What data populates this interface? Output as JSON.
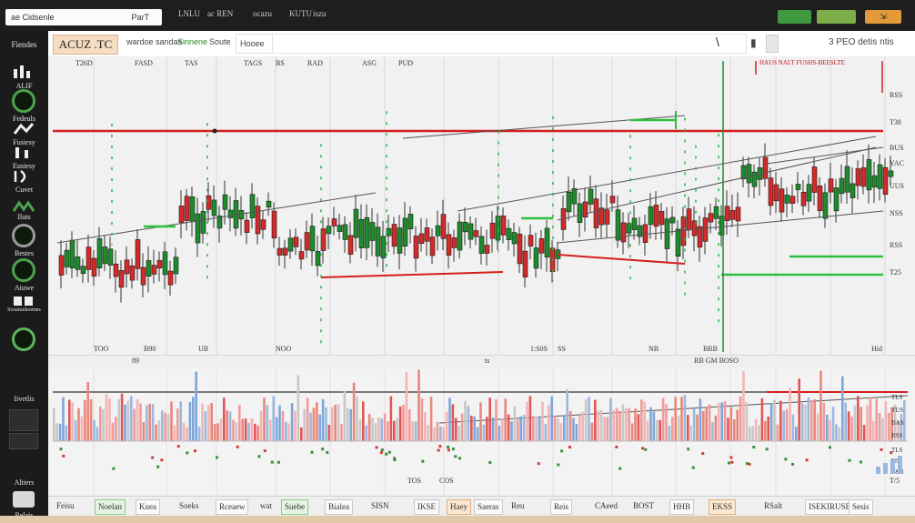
{
  "topbar": {
    "address": "ae Cidsenle",
    "address_right": "ParT",
    "menus": [
      "LNLU",
      "ac REN",
      "ocazu",
      "KUTU",
      "iszu"
    ],
    "buttons": [
      {
        "color": "#3f9a3f"
      },
      {
        "color": "#7eae4a"
      },
      {
        "color": "#e59a3a"
      }
    ]
  },
  "sidebar": {
    "title": "Fiendes",
    "items": [
      {
        "label": "ALIF",
        "icon": "chart-icon"
      },
      {
        "label": "Fedeuls",
        "icon": "ring-icon"
      },
      {
        "label": "Fusiesy",
        "icon": "candle-icon"
      },
      {
        "label": "Eusiesy",
        "icon": "bars-icon"
      },
      {
        "label": "Cuvet",
        "icon": "line-icon"
      },
      {
        "label": "Iluts",
        "icon": "wave-icon"
      },
      {
        "label": "Bestes",
        "icon": "ring-icon"
      },
      {
        "label": "Aiuwe",
        "icon": "ring-icon"
      },
      {
        "label": "Scoatunlenrnes",
        "icon": "grid-icon"
      },
      {
        "label": "Iivetlis",
        "icon": "ring-icon"
      },
      {
        "label": "Altiers",
        "icon": "square-icon"
      },
      {
        "label": "Relais",
        "icon": "square-icon"
      }
    ]
  },
  "toolbar": {
    "symbol": "ACUZ .TC",
    "labels": [
      "wardoe sandas",
      "Sinnene",
      "Soute",
      "Hooee"
    ],
    "right_label": "3 PEO detis ntis",
    "pencil": "\\",
    "zoom": "▮"
  },
  "price_axis": {
    "top_text": "HAUS NALT FUSHS-BEESLTE",
    "labels": [
      "RSS",
      "T38",
      "BUS",
      "YAC",
      "UUS",
      "NSS",
      "RSS",
      "T25"
    ]
  },
  "chart_top_labels": [
    "T26D",
    "FASD",
    "TAS",
    "TAGS",
    "BS",
    "RAD",
    "ASG",
    "PUD"
  ],
  "time_axis": [
    "TOO",
    "B90",
    "UB",
    "NOO",
    "1:S0S",
    "SS",
    "NB",
    "BRB",
    "Hid"
  ],
  "divider": {
    "left": "89",
    "mid": "ts",
    "right": "RB GM BOSO"
  },
  "volume_axis": [
    "TLS",
    "TUS",
    "BAS",
    "RSS",
    "TLS",
    "NS",
    "T&8"
  ],
  "volume_time": [
    "TOS",
    "COS",
    "T/5"
  ],
  "bottombar": {
    "items": [
      "Feisu",
      "Noelan",
      "Kuea",
      "Soeks",
      "Rceaew",
      "wat",
      "Suebe",
      "Bialea",
      "SISN",
      "IKSE",
      "Haey",
      "Saeras",
      "Reu",
      "Reis",
      "CAeed",
      "BOST",
      "HHB",
      "EKSS",
      "RSalt",
      "ISEKIRUSE",
      "Sesis"
    ]
  },
  "colors": {
    "up": "#1f8c2c",
    "down": "#d42a2a",
    "accent_green": "#2fbf3a",
    "line": "#444444"
  }
}
